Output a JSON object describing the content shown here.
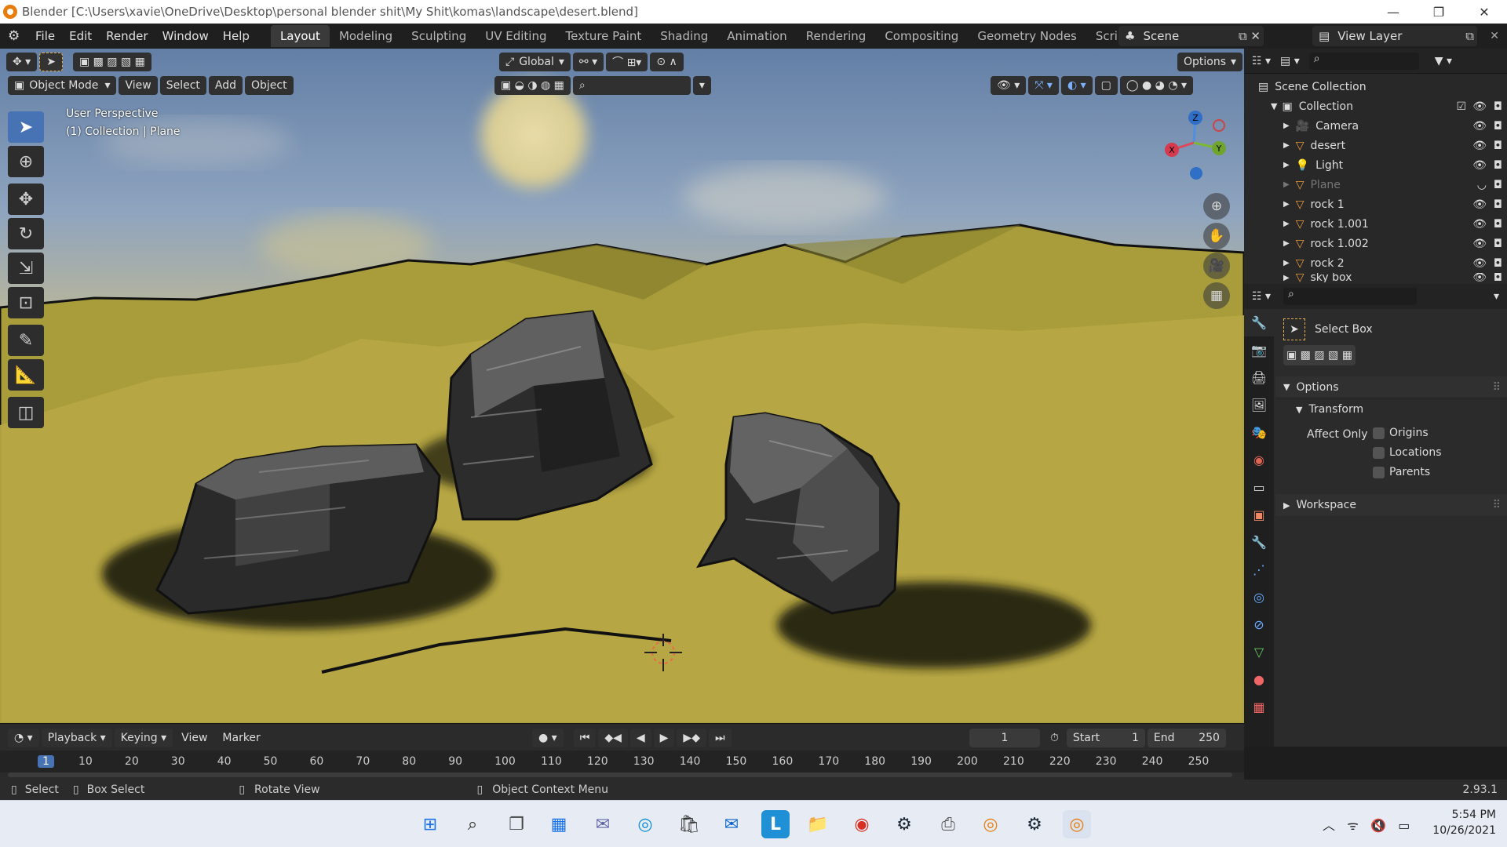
{
  "window": {
    "title": "Blender [C:\\Users\\xavie\\OneDrive\\Desktop\\personal blender shit\\My Shit\\komas\\landscape\\desert.blend]"
  },
  "menu": [
    "File",
    "Edit",
    "Render",
    "Window",
    "Help"
  ],
  "workspaces": [
    "Layout",
    "Modeling",
    "Sculpting",
    "UV Editing",
    "Texture Paint",
    "Shading",
    "Animation",
    "Rendering",
    "Compositing",
    "Geometry Nodes",
    "Scripting"
  ],
  "active_workspace": "Layout",
  "scene": {
    "label": "Scene"
  },
  "view_layer": {
    "label": "View Layer"
  },
  "viewport": {
    "transform_orientation": "Global",
    "options_label": "Options",
    "mode": "Object Mode",
    "menus": [
      "View",
      "Select",
      "Add",
      "Object"
    ],
    "overlay_line1": "User Perspective",
    "overlay_line2": "(1) Collection | Plane",
    "gizmo": {
      "x": "X",
      "y": "Y",
      "z": "Z"
    }
  },
  "outliner": {
    "scene_collection": "Scene Collection",
    "collection": "Collection",
    "items": [
      {
        "name": "Camera"
      },
      {
        "name": "desert"
      },
      {
        "name": "Light"
      },
      {
        "name": "Plane",
        "dimmed": true
      },
      {
        "name": "rock 1"
      },
      {
        "name": "rock 1.001"
      },
      {
        "name": "rock 1.002"
      },
      {
        "name": "rock 2"
      },
      {
        "name": "sky box"
      }
    ]
  },
  "properties": {
    "tool_name": "Select Box",
    "options_label": "Options",
    "transform_label": "Transform",
    "affect_only_label": "Affect Only",
    "checkboxes": [
      "Origins",
      "Locations",
      "Parents"
    ],
    "workspace_label": "Workspace"
  },
  "timeline": {
    "menus": [
      "Playback",
      "Keying",
      "View",
      "Marker"
    ],
    "current_frame": "1",
    "start_label": "Start",
    "start_value": "1",
    "end_label": "End",
    "end_value": "250",
    "ruler": [
      "1",
      "10",
      "20",
      "30",
      "40",
      "50",
      "60",
      "70",
      "80",
      "90",
      "100",
      "110",
      "120",
      "130",
      "140",
      "150",
      "160",
      "170",
      "180",
      "190",
      "200",
      "210",
      "220",
      "230",
      "240",
      "250"
    ]
  },
  "statusbar": {
    "select": "Select",
    "box_select": "Box Select",
    "rotate_view": "Rotate View",
    "context_menu": "Object Context Menu",
    "version": "2.93.1"
  },
  "taskbar": {
    "time": "5:54 PM",
    "date": "10/26/2021"
  }
}
